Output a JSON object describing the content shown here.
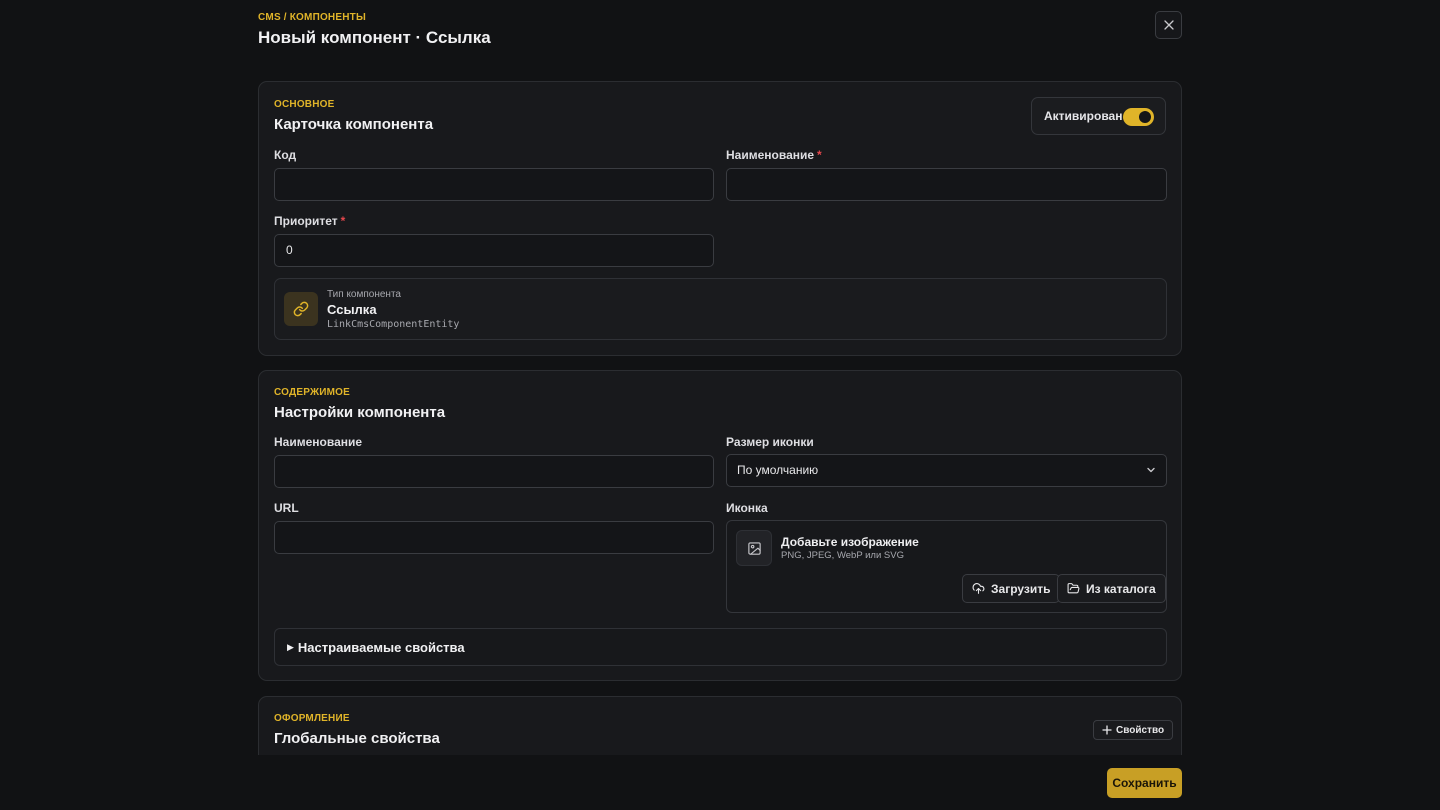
{
  "header": {
    "breadcrumb": "CMS / КОМПОНЕНТЫ",
    "title": "Новый компонент · Ссылка"
  },
  "main_card": {
    "eyebrow": "ОСНОВНОЕ",
    "title": "Карточка компонента",
    "active_label": "Активирован",
    "active": true,
    "code_label": "Код",
    "code_value": "",
    "name_label": "Наименование",
    "name_value": "",
    "priority_label": "Приоритет",
    "priority_value": "0",
    "required_mark": "*",
    "type_caption": "Тип компонента",
    "type_name": "Ссылка",
    "type_entity": "LinkCmsComponentEntity"
  },
  "content_card": {
    "eyebrow": "СОДЕРЖИМОЕ",
    "title": "Настройки компонента",
    "name_label": "Наименование",
    "name_value": "",
    "icon_size_label": "Размер иконки",
    "icon_size_value": "По умолчанию",
    "url_label": "URL",
    "url_value": "",
    "icon_label": "Иконка",
    "upload_title": "Добавьте изображение",
    "upload_subtitle": "PNG, JPEG, WebP или SVG",
    "upload_button": "Загрузить",
    "catalog_button": "Из каталога",
    "custom_props_label": "Настраиваемые свойства"
  },
  "design_card": {
    "eyebrow": "ОФОРМЛЕНИЕ",
    "title": "Глобальные свойства",
    "add_property_button": "Свойство"
  },
  "footer": {
    "save_button": "Сохранить"
  },
  "colors": {
    "accent": "#e0b429",
    "background": "#111214",
    "card": "#18191c",
    "required": "#e5484d"
  }
}
